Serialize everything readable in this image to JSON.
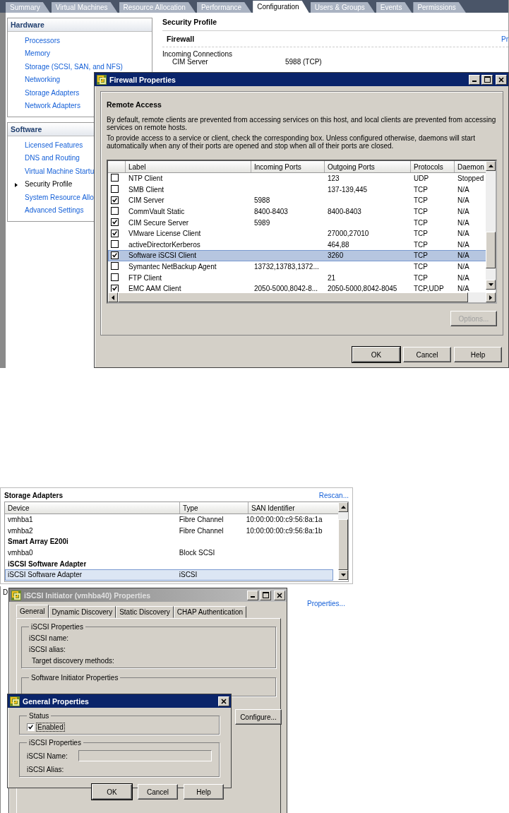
{
  "top_tabs": [
    {
      "label": "Summary",
      "selected": false
    },
    {
      "label": "Virtual Machines",
      "selected": false
    },
    {
      "label": "Resource Allocation",
      "selected": false
    },
    {
      "label": "Performance",
      "selected": false
    },
    {
      "label": "Configuration",
      "selected": true
    },
    {
      "label": "Users & Groups",
      "selected": false
    },
    {
      "label": "Events",
      "selected": false
    },
    {
      "label": "Permissions",
      "selected": false
    }
  ],
  "sidebar": [
    {
      "title": "Hardware",
      "items": [
        {
          "label": "Processors",
          "selected": false
        },
        {
          "label": "Memory",
          "selected": false
        },
        {
          "label": "Storage (SCSI, SAN, and NFS)",
          "selected": false
        },
        {
          "label": "Networking",
          "selected": false
        },
        {
          "label": "Storage Adapters",
          "selected": false
        },
        {
          "label": "Network Adapters",
          "selected": false
        }
      ]
    },
    {
      "title": "Software",
      "items": [
        {
          "label": "Licensed Features",
          "selected": false
        },
        {
          "label": "DNS and Routing",
          "selected": false
        },
        {
          "label": "Virtual Machine Startu",
          "selected": false
        },
        {
          "label": "Security Profile",
          "selected": true
        },
        {
          "label": "System Resource Allo",
          "selected": false
        },
        {
          "label": "Advanced Settings",
          "selected": false
        }
      ]
    }
  ],
  "security_profile": {
    "title": "Security Profile",
    "section": "Firewall",
    "link": "Pr",
    "group": "Incoming Connections",
    "rows": [
      {
        "name": "CIM Server",
        "value": "5988 (TCP)"
      }
    ]
  },
  "firewall_dialog": {
    "title": "Firewall Properties",
    "heading": "Remote Access",
    "paragraphs": [
      "By default, remote clients are prevented from accessing services on this host, and local clients are prevented from accessing services on remote hosts.",
      "To provide access to a service or client, check the corresponding box. Unless configured otherwise, daemons will start automatically when any of their ports are opened and stop when all of their ports are closed."
    ],
    "columns": [
      "Label",
      "Incoming Ports",
      "Outgoing Ports",
      "Protocols",
      "Daemon"
    ],
    "rows": [
      {
        "checked": false,
        "selected": false,
        "cells": [
          "NTP Client",
          "",
          "123",
          "UDP",
          "Stopped"
        ]
      },
      {
        "checked": false,
        "selected": false,
        "cells": [
          "SMB Client",
          "",
          "137-139,445",
          "TCP",
          "N/A"
        ]
      },
      {
        "checked": true,
        "selected": false,
        "cells": [
          "CIM Server",
          "5988",
          "",
          "TCP",
          "N/A"
        ]
      },
      {
        "checked": false,
        "selected": false,
        "cells": [
          "CommVault Static",
          "8400-8403",
          "8400-8403",
          "TCP",
          "N/A"
        ]
      },
      {
        "checked": true,
        "selected": false,
        "cells": [
          "CIM Secure Server",
          "5989",
          "",
          "TCP",
          "N/A"
        ]
      },
      {
        "checked": true,
        "selected": false,
        "cells": [
          "VMware License Client",
          "",
          "27000,27010",
          "TCP",
          "N/A"
        ]
      },
      {
        "checked": false,
        "selected": false,
        "cells": [
          "activeDirectorKerberos",
          "",
          "464,88",
          "TCP",
          "N/A"
        ]
      },
      {
        "checked": true,
        "selected": true,
        "cells": [
          "Software iSCSI Client",
          "",
          "3260",
          "TCP",
          "N/A"
        ]
      },
      {
        "checked": false,
        "selected": false,
        "cells": [
          "Symantec NetBackup Agent",
          "13732,13783,1372...",
          "",
          "TCP",
          "N/A"
        ]
      },
      {
        "checked": false,
        "selected": false,
        "cells": [
          "FTP Client",
          "",
          "21",
          "TCP",
          "N/A"
        ]
      },
      {
        "checked": true,
        "selected": false,
        "cells": [
          "EMC AAM Client",
          "2050-5000,8042-8...",
          "2050-5000,8042-8045",
          "TCP,UDP",
          "N/A"
        ]
      }
    ],
    "options_button": {
      "label": "Options...",
      "disabled": true
    },
    "buttons": [
      "OK",
      "Cancel",
      "Help"
    ]
  },
  "storage_adapters": {
    "title": "Storage Adapters",
    "link": "Rescan...",
    "columns": [
      "Device",
      "Type",
      "SAN Identifier"
    ],
    "rows": [
      {
        "kind": "item",
        "selected": false,
        "cells": [
          "vmhba1",
          "Fibre Channel",
          "10:00:00:00:c9:56:8a:1a"
        ]
      },
      {
        "kind": "item",
        "selected": false,
        "cells": [
          "vmhba2",
          "Fibre Channel",
          "10:00:00:00:c9:56:8a:1b"
        ]
      },
      {
        "kind": "group",
        "cells": [
          "Smart Array E200i"
        ]
      },
      {
        "kind": "item",
        "selected": false,
        "cells": [
          "vmhba0",
          "Block SCSI",
          ""
        ]
      },
      {
        "kind": "group",
        "cells": [
          "iSCSI Software Adapter"
        ]
      },
      {
        "kind": "item",
        "selected": true,
        "cells": [
          "iSCSI Software Adapter",
          "iSCSI",
          ""
        ]
      }
    ]
  },
  "details_panel": {
    "label": "D",
    "link": "Properties..."
  },
  "iscsi_dialog": {
    "title": "iSCSI Initiator (vmhba40) Properties",
    "tabs": [
      {
        "label": "General",
        "selected": true
      },
      {
        "label": "Dynamic Discovery",
        "selected": false
      },
      {
        "label": "Static Discovery",
        "selected": false
      },
      {
        "label": "CHAP Authentication",
        "selected": false
      }
    ],
    "iscsi_group": {
      "legend": "iSCSI Properties",
      "fields": [
        "iSCSI name:",
        "iSCSI alias:",
        "Target discovery methods:"
      ]
    },
    "initiator_group": {
      "legend": "Software Initiator Properties"
    },
    "configure_button": "Configure..."
  },
  "general_dialog": {
    "title": "General Properties",
    "status_legend": "Status",
    "enabled": {
      "label": "Enabled",
      "checked": true
    },
    "props_legend": "iSCSI Properties",
    "name_label": "iSCSI Name:",
    "alias_label": "iSCSI Alias:",
    "buttons": [
      "OK",
      "Cancel",
      "Help"
    ]
  }
}
